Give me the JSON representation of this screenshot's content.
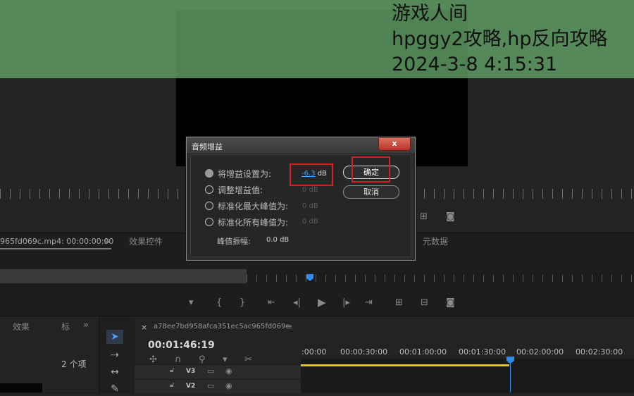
{
  "watermark": {
    "line1": "游戏人间",
    "line2": "hpggy2攻略,hp反向攻略",
    "line3": "2024-3-8 4:15:31"
  },
  "source_panel": {
    "clip_tab": "965fd069c.mp4: 00:00:00:00",
    "effects_tab": "效果控件",
    "metadata_tab": "元数据"
  },
  "project_panel": {
    "effects_label": "效果",
    "tab_marker": "标",
    "overflow": "»",
    "item_count": "2 个项"
  },
  "sequence": {
    "close": "×",
    "name": "a78ee7bd958afca351ec5ac965fd069c",
    "menu": "≡",
    "timecode": "00:01:46:19",
    "ruler_labels": [
      ":00:00",
      "00:00:30:00",
      "00:01:00:00",
      "00:01:30:00",
      "00:02:00:00",
      "00:02:30:00"
    ],
    "tracks": [
      "V3",
      "V2"
    ]
  },
  "dialog": {
    "title": "音频增益",
    "close_glyph": "x",
    "options": [
      {
        "label": "将增益设置为:",
        "value": "-6.3",
        "unit": "dB",
        "selected": true
      },
      {
        "label": "调整增益值:",
        "value": "0 dB",
        "selected": false
      },
      {
        "label": "标准化最大峰值为:",
        "value": "0 dB",
        "selected": false
      },
      {
        "label": "标准化所有峰值为:",
        "value": "0 dB",
        "selected": false
      }
    ],
    "peak_label": "峰值振幅:",
    "peak_value": "0.0 dB",
    "ok_label": "确定",
    "cancel_label": "取消"
  },
  "colors": {
    "accent": "#2d8ceb",
    "highlight_box": "#d51f23",
    "clip_bar": "#e8c22d",
    "overlay": "#62a066"
  }
}
